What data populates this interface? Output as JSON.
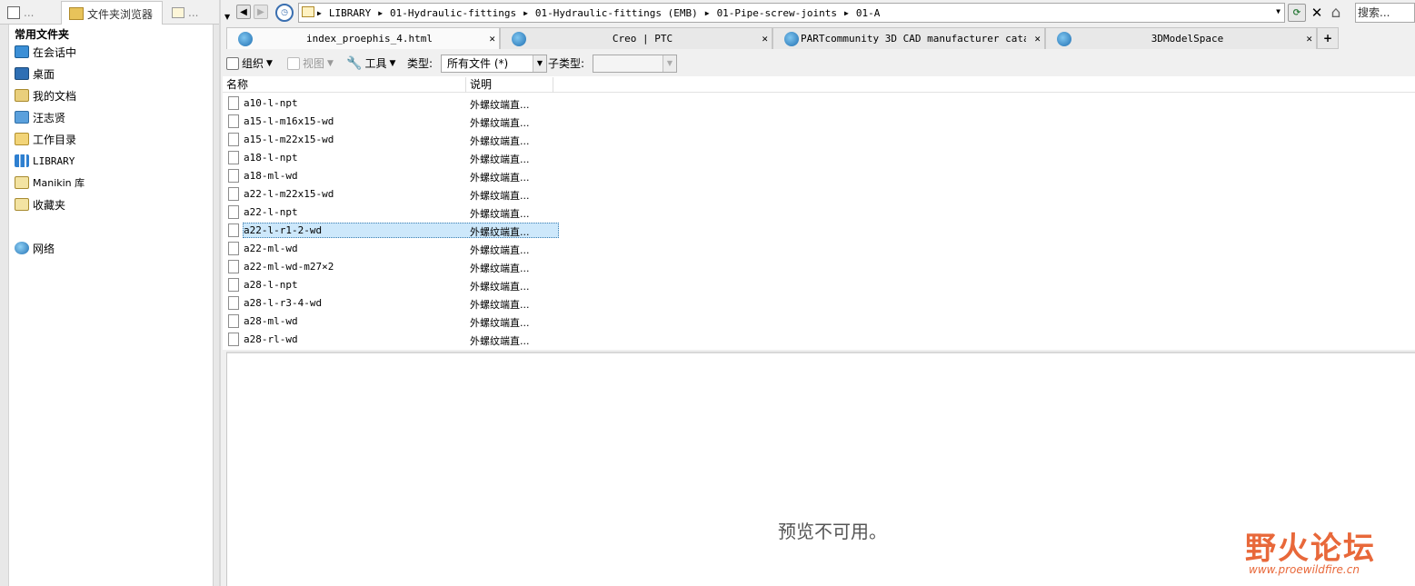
{
  "left_panel": {
    "tabs": [
      "...",
      "文件夹浏览器",
      "..."
    ],
    "favorites_title": "常用文件夹",
    "favorites": [
      {
        "label": "在会话中",
        "icon": "monitor-icon"
      },
      {
        "label": "桌面",
        "icon": "desktop-icon"
      },
      {
        "label": "我的文档",
        "icon": "documents-icon"
      },
      {
        "label": "汪志贤",
        "icon": "computer-icon"
      },
      {
        "label": "工作目录",
        "icon": "working-dir-icon"
      },
      {
        "label": "LIBRARY",
        "icon": "library-icon"
      },
      {
        "label": "Manikin 库",
        "icon": "manikin-library-icon"
      },
      {
        "label": "收藏夹",
        "icon": "favorites-icon"
      },
      {
        "label": "网络",
        "icon": "network-icon"
      }
    ]
  },
  "address_bar": {
    "path": [
      "LIBRARY",
      "01-Hydraulic-fittings",
      "01-Hydraulic-fittings (EMB)",
      "01-Pipe-screw-joints",
      "01-A"
    ]
  },
  "search": {
    "placeholder": "搜索..."
  },
  "browser_tabs": [
    {
      "title": "index_proephis_4.html",
      "active": true
    },
    {
      "title": "Creo | PTC",
      "active": false
    },
    {
      "title": "PARTcommunity 3D CAD manufacturer cata...",
      "active": false
    },
    {
      "title": "3DModelSpace",
      "active": false
    }
  ],
  "toolbar": {
    "organize": "组织",
    "view": "视图",
    "tools": "工具",
    "type_label": "类型:",
    "type_value": "所有文件 (*)",
    "subtype_label": "子类型:",
    "subtype_value": ""
  },
  "file_list": {
    "columns": [
      "名称",
      "说明"
    ],
    "rows": [
      {
        "name": "a10-l-npt",
        "desc": "外螺纹端直..."
      },
      {
        "name": "a15-l-m16x15-wd",
        "desc": "外螺纹端直..."
      },
      {
        "name": "a15-l-m22x15-wd",
        "desc": "外螺纹端直..."
      },
      {
        "name": "a18-l-npt",
        "desc": "外螺纹端直..."
      },
      {
        "name": "a18-ml-wd",
        "desc": "外螺纹端直..."
      },
      {
        "name": "a22-l-m22x15-wd",
        "desc": "外螺纹端直..."
      },
      {
        "name": "a22-l-npt",
        "desc": "外螺纹端直..."
      },
      {
        "name": "a22-l-r1-2-wd",
        "desc": "外螺纹端直...",
        "selected": true
      },
      {
        "name": "a22-ml-wd",
        "desc": "外螺纹端直..."
      },
      {
        "name": "a22-ml-wd-m27×2",
        "desc": "外螺纹端直..."
      },
      {
        "name": "a28-l-npt",
        "desc": "外螺纹端直..."
      },
      {
        "name": "a28-l-r3-4-wd",
        "desc": "外螺纹端直..."
      },
      {
        "name": "a28-ml-wd",
        "desc": "外螺纹端直..."
      },
      {
        "name": "a28-rl-wd",
        "desc": "外螺纹端直..."
      }
    ]
  },
  "preview": {
    "message": "预览不可用。"
  },
  "watermark": {
    "text": "野火论坛",
    "url": "www.proewildfire.cn"
  }
}
